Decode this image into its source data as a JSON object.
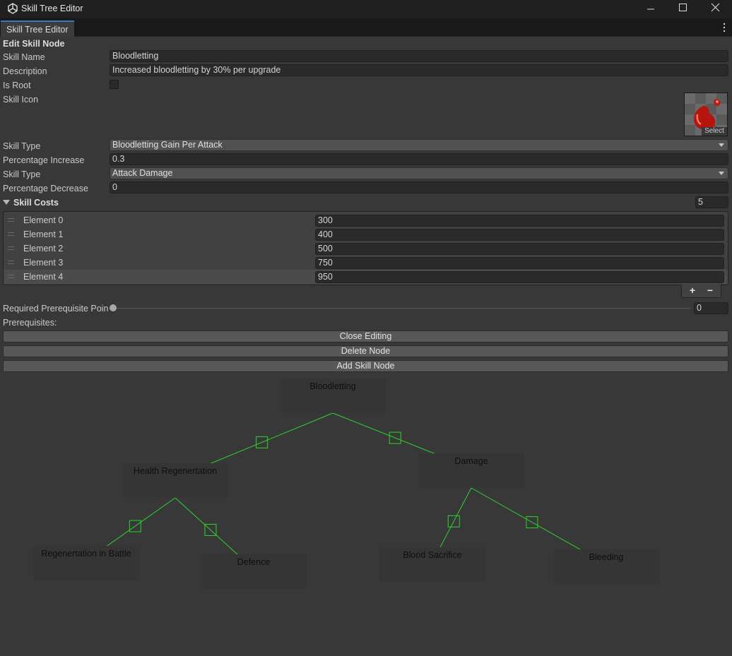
{
  "window": {
    "title": "Skill Tree Editor"
  },
  "tab": {
    "label": "Skill Tree Editor"
  },
  "section": {
    "title": "Edit Skill Node"
  },
  "fields": {
    "skill_name_label": "Skill Name",
    "skill_name_value": "Bloodletting",
    "description_label": "Description",
    "description_value": "Increased bloodletting by 30% per upgrade",
    "is_root_label": "Is Root",
    "is_root_checked": false,
    "skill_icon_label": "Skill Icon",
    "skill_icon_select": "Select",
    "skill_type_1_label": "Skill Type",
    "skill_type_1_value": "Bloodletting Gain Per Attack",
    "percentage_increase_label": "Percentage Increase",
    "percentage_increase_value": "0.3",
    "skill_type_2_label": "Skill Type",
    "skill_type_2_value": "Attack Damage",
    "percentage_decrease_label": "Percentage Decrease",
    "percentage_decrease_value": "0"
  },
  "skill_costs": {
    "label": "Skill Costs",
    "count": "5",
    "elements": [
      {
        "label": "Element 0",
        "value": "300"
      },
      {
        "label": "Element 1",
        "value": "400"
      },
      {
        "label": "Element 2",
        "value": "500"
      },
      {
        "label": "Element 3",
        "value": "750"
      },
      {
        "label": "Element 4",
        "value": "950"
      }
    ],
    "add_label": "+",
    "remove_label": "−"
  },
  "prereq": {
    "points_label": "Required Prerequisite Poin",
    "points_value": "0",
    "prerequisites_label": "Prerequisites:"
  },
  "buttons": {
    "close_editing": "Close Editing",
    "delete_node": "Delete Node",
    "add_skill_node": "Add Skill Node"
  },
  "graph": {
    "nodes": [
      {
        "id": "bloodletting",
        "label": "Bloodletting"
      },
      {
        "id": "health-regen",
        "label": "Health Regenertation"
      },
      {
        "id": "damage",
        "label": "Damage"
      },
      {
        "id": "regen-battle",
        "label": "Regenertation in Battle"
      },
      {
        "id": "defence",
        "label": "Defence"
      },
      {
        "id": "blood-sacrifice",
        "label": "Blood Sacrifice"
      },
      {
        "id": "bleeding",
        "label": "Bleeding"
      }
    ],
    "edges": [
      [
        "bloodletting",
        "health-regen"
      ],
      [
        "bloodletting",
        "damage"
      ],
      [
        "health-regen",
        "regen-battle"
      ],
      [
        "health-regen",
        "defence"
      ],
      [
        "damage",
        "blood-sacrifice"
      ],
      [
        "damage",
        "bleeding"
      ]
    ],
    "edge_color": "#2bd42b"
  }
}
